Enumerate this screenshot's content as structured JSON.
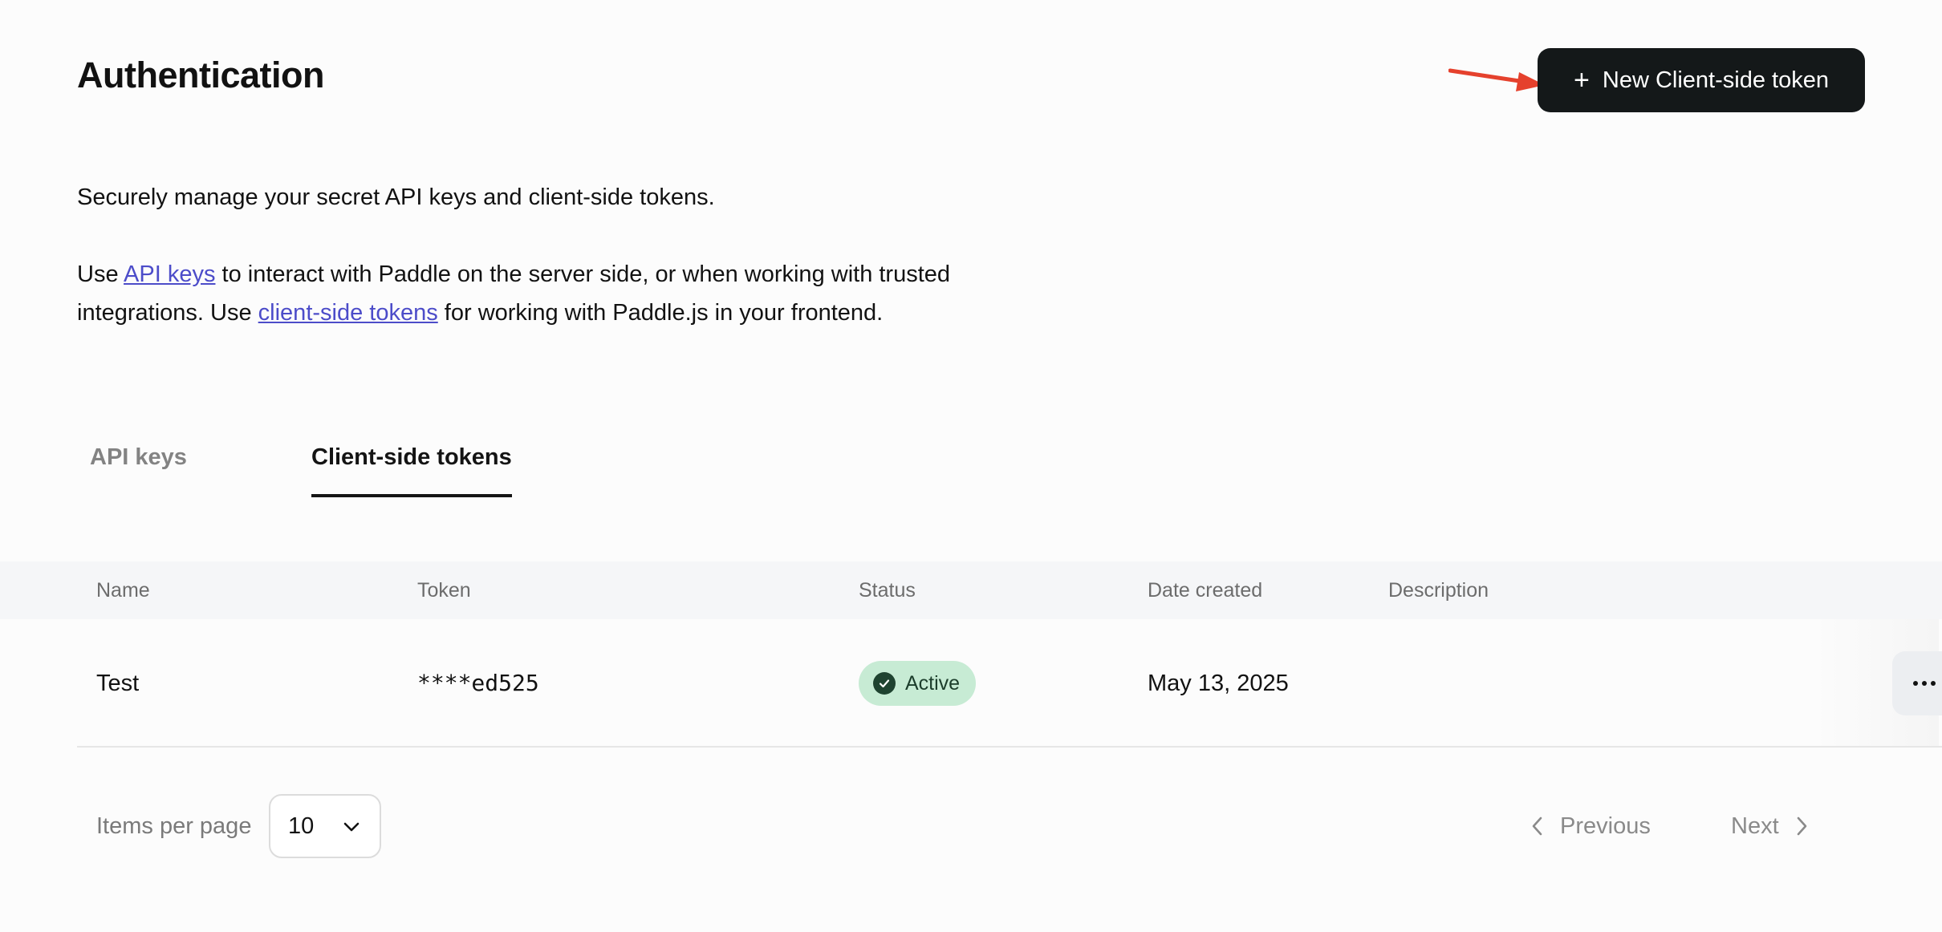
{
  "header": {
    "title": "Authentication",
    "new_token_label": "New Client-side token",
    "new_token_icon": "plus-icon",
    "annotation_arrow_color": "#e5412d"
  },
  "intro": {
    "line1": "Securely manage your secret API keys and client-side tokens.",
    "p2_part1": "Use ",
    "p2_link1": "API keys",
    "p2_part2": " to interact with Paddle on the server side, or when working with trusted integrations. Use ",
    "p2_link2": "client-side tokens",
    "p2_part3": " for working with Paddle.js in your frontend.",
    "link_color": "#4c4cc9"
  },
  "tabs": [
    {
      "label": "API keys",
      "active": false
    },
    {
      "label": "Client-side tokens",
      "active": true
    }
  ],
  "table": {
    "columns": [
      "Name",
      "Token",
      "Status",
      "Date created",
      "Description"
    ],
    "rows": [
      {
        "name": "Test",
        "token": "****ed525",
        "status": "Active",
        "date_created": "May 13, 2025",
        "description": ""
      }
    ],
    "status_colors": {
      "active_bg": "#c7ebd4",
      "active_fg": "#1c3d2b"
    }
  },
  "pagination": {
    "items_per_page_label": "Items per page",
    "items_per_page_value": "10",
    "previous_label": "Previous",
    "next_label": "Next"
  },
  "colors": {
    "primary_button": "#141819",
    "background": "#fcfcfc",
    "header_row_bg": "#f5f6f8"
  }
}
